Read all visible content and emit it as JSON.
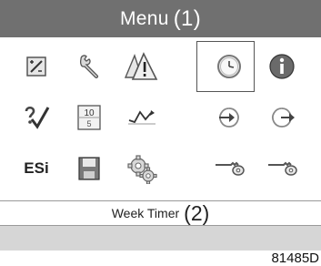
{
  "header": {
    "title": "Menu",
    "callout": "(1)"
  },
  "grid": {
    "selected": "week-timer",
    "icons": [
      [
        "edit-icon",
        "wrench-icon",
        "warning-icon",
        "clock-icon",
        "info-icon"
      ],
      [
        "check-icon",
        "counter-icon",
        "trend-icon",
        "input-arrow-icon",
        "output-arrow-icon"
      ],
      [
        "esi-icon",
        "save-icon",
        "settings-icon",
        "key-icon",
        "key-user-icon"
      ]
    ],
    "esi_label": "ESi",
    "counter_top": "10",
    "counter_digit": "5"
  },
  "status": {
    "label": "Week Timer",
    "callout": "(2)"
  },
  "figure_ref": "81485D"
}
